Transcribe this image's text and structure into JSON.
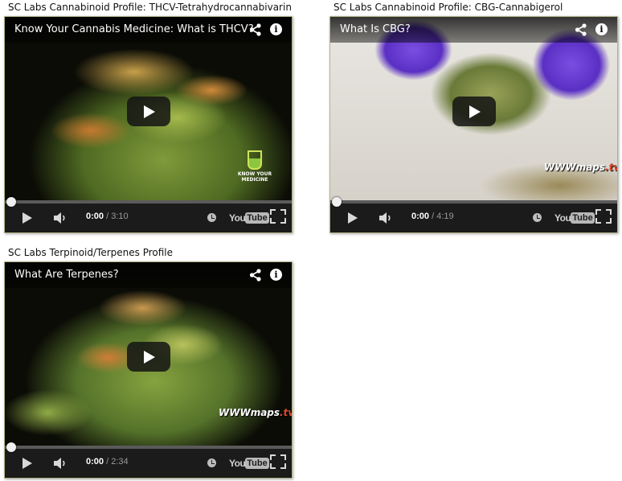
{
  "videos": [
    {
      "caption": "SC Labs Cannabinoid Profile: THCV-Tetrahydrocannabivarin",
      "title": "Know Your Cannabis Medicine: What is THCV?",
      "current_time": "0:00",
      "duration": "/ 3:10",
      "progress_fraction": 0,
      "watermark": "KNOW YOUR MEDICINE",
      "thumbnail_icon": "cannabis-bud"
    },
    {
      "caption": "SC Labs Cannabinoid Profile: CBG-Cannabigerol",
      "title": "What Is CBG?",
      "current_time": "0:00",
      "duration": "/ 4:19",
      "progress_fraction": 0,
      "watermark_main": "WWWmaps",
      "watermark_suffix": ".tv",
      "thumbnail_icon": "gloved-hands-with-bud"
    },
    {
      "caption": "SC Labs Terpinoid/Terpenes Profile",
      "title": "What Are Terpenes?",
      "current_time": "0:00",
      "duration": "/ 2:34",
      "progress_fraction": 0,
      "watermark_main": "WWWmaps",
      "watermark_suffix": ".tv",
      "thumbnail_icon": "cannabis-bud"
    }
  ],
  "youtube_logo": {
    "you": "You",
    "tube": "Tube"
  },
  "info_glyph": "i",
  "colors": {
    "border": "#b5b48a",
    "control_bar": "#1b1b1b",
    "watermark_accent": "#e0482a"
  }
}
